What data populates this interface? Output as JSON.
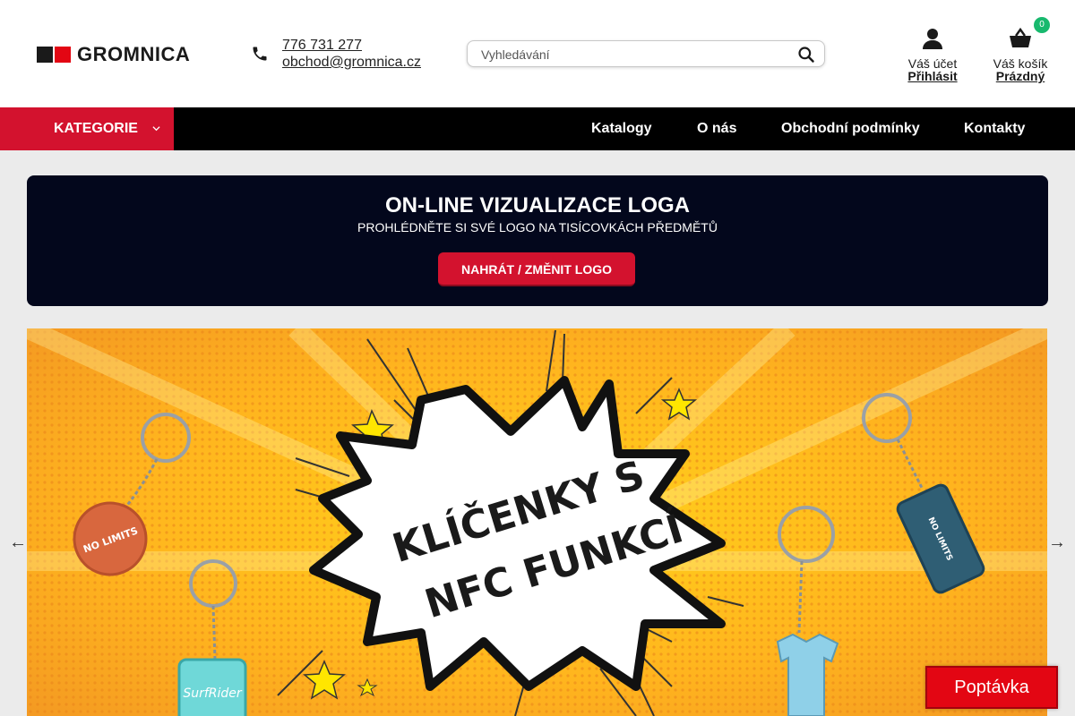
{
  "brand": {
    "name": "GROMNICA",
    "colors": {
      "red": "#e30613",
      "dark": "#1a1a1a",
      "nav_bg": "#000000",
      "category_red": "#d3122e",
      "badge_green": "#18b96e"
    }
  },
  "contact": {
    "phone": "776 731 277",
    "email": "obchod@gromnica.cz",
    "icon": "phone-icon"
  },
  "search": {
    "placeholder": "Vyhledávání",
    "icon": "search-icon"
  },
  "account": {
    "label": "Váš účet",
    "link": "Přihlásit",
    "icon": "user-icon"
  },
  "cart": {
    "label": "Váš košík",
    "link": "Prázdný",
    "count": "0",
    "icon": "basket-icon"
  },
  "nav": {
    "category_label": "KATEGORIE",
    "items": [
      {
        "label": "Katalogy"
      },
      {
        "label": "O nás"
      },
      {
        "label": "Obchodní podmínky"
      },
      {
        "label": "Kontakty"
      }
    ]
  },
  "promo": {
    "title": "ON-LINE VIZUALIZACE LOGA",
    "subtitle": "PROHLÉDNĚTE SI SVÉ LOGO NA TISÍCOVKÁCH PŘEDMĚTŮ",
    "button": "NAHRÁT / ZMĚNIT LOGO"
  },
  "banner": {
    "line1": "KLÍČENKY S",
    "line2": "NFC FUNKCÍ",
    "keychain_texts": [
      "NO LIMITS",
      "SurfRider",
      "NO LIMITS"
    ],
    "prev": "←",
    "next": "→"
  },
  "quote_button": "Poptávka"
}
